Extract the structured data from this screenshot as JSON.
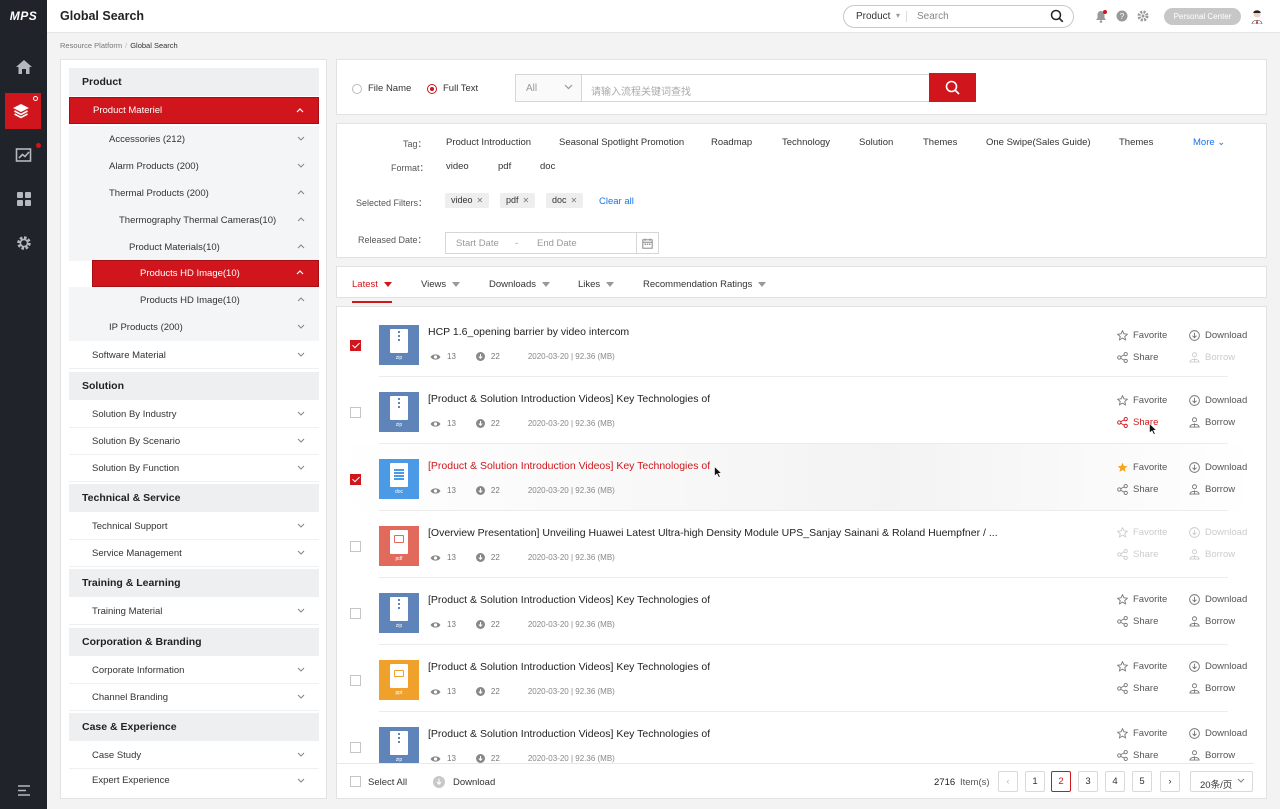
{
  "app": {
    "logo": "MPS",
    "title": "Global Search"
  },
  "header": {
    "search_scope": "Product",
    "search_placeholder": "Search",
    "personal_center": "Personal Center"
  },
  "nav": {
    "items": [
      "home-icon",
      "layers-icon",
      "chart-icon",
      "apps-icon",
      "settings-icon",
      "menu-icon"
    ]
  },
  "breadcrumb": {
    "root": "Resource Platform",
    "current": "Global Search"
  },
  "sidebar": {
    "product": "Product",
    "product_materiel": "Product Materiel",
    "accessories": "Accessories (212)",
    "alarm_products": "Alarm Products (200)",
    "thermal_products": "Thermal Products (200)",
    "thermography_cameras": "Thermography Thermal Cameras(10)",
    "product_materials": "Product Materials(10)",
    "products_hd_image_active": "Products HD Image(10)",
    "products_hd_image": "Products HD Image(10)",
    "ip_products": "IP Products (200)",
    "software_material": "Software Material",
    "solution": "Solution",
    "solution_by_industry": "Solution By Industry",
    "solution_by_scenario": "Solution By Scenario",
    "solution_by_function": "Solution By Function",
    "technical_service": "Technical & Service",
    "technical_support": "Technical Support",
    "service_management": "Service Management",
    "training_learning": "Training & Learning",
    "training_material": "Training Material",
    "corporation_branding": "Corporation & Branding",
    "corporate_information": "Corporate Information",
    "channel_branding": "Channel Branding",
    "case_experience": "Case & Experience",
    "case_study": "Case Study",
    "expert_experience": "Expert Experience"
  },
  "search": {
    "file_name": "File Name",
    "full_text": "Full Text",
    "scope": "All",
    "placeholder": "请输入流程关键词查找"
  },
  "filters": {
    "tag_label": "Tag：",
    "tags": [
      "Product Introduction",
      "Seasonal Spotlight Promotion",
      "Roadmap",
      "Technology",
      "Solution",
      "Themes",
      "One Swipe(Sales Guide)",
      "Themes"
    ],
    "more": "More",
    "format_label": "Format：",
    "formats": [
      "video",
      "pdf",
      "doc"
    ],
    "selected_label": "Selected Filters：",
    "selected": [
      "video",
      "pdf",
      "doc"
    ],
    "clear_all": "Clear all",
    "released_label": "Released Date：",
    "start_date": "Start Date",
    "range_sep": "-",
    "end_date": "End Date"
  },
  "sort": {
    "latest": "Latest",
    "views": "Views",
    "downloads": "Downloads",
    "likes": "Likes",
    "ratings": "Recommendation Ratings"
  },
  "actions": {
    "favorite": "Favorite",
    "share": "Share",
    "download": "Download",
    "borrow": "Borrow"
  },
  "colors": {
    "brand_red": "#d0161c",
    "zip": "#5f84b9",
    "doc": "#3e8fe0",
    "pdf": "#e16a5c",
    "ppt": "#f0a12b",
    "nav_bg": "#20232a"
  },
  "results": [
    {
      "title": "HCP 1.6_opening barrier by video intercom",
      "views": "13",
      "downloads": "22",
      "info": "2020-03-20 | 92.36 (MB)",
      "type": "zip"
    },
    {
      "title": "[Product & Solution Introduction Videos] Key Technologies of",
      "views": "13",
      "downloads": "22",
      "info": "2020-03-20 | 92.36 (MB)",
      "type": "zip"
    },
    {
      "title": "[Product & Solution Introduction Videos] Key Technologies of",
      "views": "13",
      "downloads": "22",
      "info": "2020-03-20 | 92.36 (MB)",
      "type": "doc"
    },
    {
      "title": "[Overview Presentation] Unveiling Huawei Latest Ultra-high Density Module UPS_Sanjay Sainani & Roland Huempfner / ...",
      "views": "13",
      "downloads": "22",
      "info": "2020-03-20 | 92.36 (MB)",
      "type": "pdf"
    },
    {
      "title": "[Product & Solution Introduction Videos] Key Technologies of",
      "views": "13",
      "downloads": "22",
      "info": "2020-03-20 | 92.36 (MB)",
      "type": "zip"
    },
    {
      "title": "[Product & Solution Introduction Videos] Key Technologies of",
      "views": "13",
      "downloads": "22",
      "info": "2020-03-20 | 92.36 (MB)",
      "type": "ppt"
    },
    {
      "title": "[Product & Solution Introduction Videos] Key Technologies of",
      "views": "13",
      "downloads": "22",
      "info": "2020-03-20 | 92.36 (MB)",
      "type": "zip"
    }
  ],
  "footer": {
    "select_all": "Select All",
    "download": "Download",
    "total": "2716",
    "items_label": "Item(s)",
    "pages": [
      "1",
      "2",
      "3",
      "4",
      "5"
    ],
    "current_page": "2",
    "page_size": "20条/页"
  }
}
